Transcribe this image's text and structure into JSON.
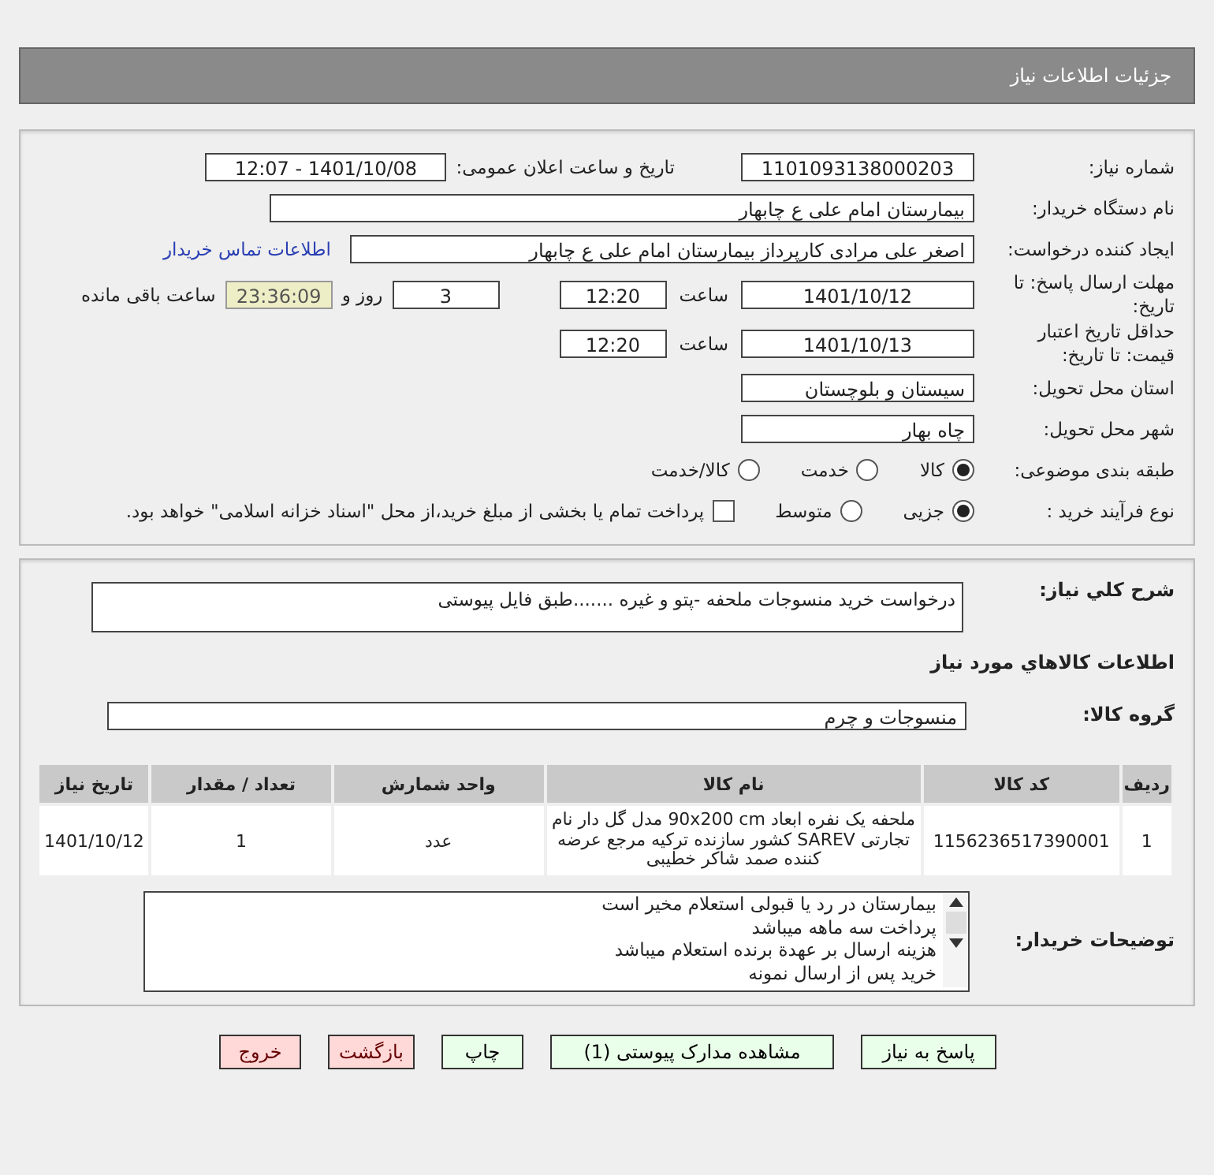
{
  "header": {
    "title": "جزئیات اطلاعات نیاز"
  },
  "need_number": {
    "label": "شماره نیاز:",
    "value": "1101093138000203"
  },
  "announce": {
    "label": "تاریخ و ساعت اعلان عمومی:",
    "value": "1401/10/08 - 12:07"
  },
  "buyer_org": {
    "label": "نام دستگاه خریدار:",
    "value": "بیمارستان امام علی  ع  چابهار"
  },
  "requester": {
    "label": "ایجاد کننده درخواست:",
    "value": "اصغر علی مرادی کارپرداز بیمارستان امام علی  ع  چابهار",
    "link": "اطلاعات تماس خریدار"
  },
  "deadline": {
    "label": "مهلت ارسال پاسخ: تا تاریخ:",
    "date": "1401/10/12",
    "time_label": "ساعت",
    "time": "12:20",
    "days": "3",
    "days_label": "روز و",
    "remaining": "23:36:09",
    "remaining_label": "ساعت باقی مانده"
  },
  "validity": {
    "label": "حداقل تاریخ اعتبار قیمت: تا تاریخ:",
    "date": "1401/10/13",
    "time_label": "ساعت",
    "time": "12:20"
  },
  "province": {
    "label": "استان محل تحویل:",
    "value": "سیستان و بلوچستان"
  },
  "city": {
    "label": "شهر محل تحویل:",
    "value": "چاه بهار"
  },
  "category": {
    "label": "طبقه بندی موضوعی:",
    "options": [
      {
        "kind": "radio",
        "label": "کالا",
        "selected": true
      },
      {
        "kind": "radio",
        "label": "خدمت",
        "selected": false
      },
      {
        "kind": "radio",
        "label": "کالا/خدمت",
        "selected": false
      }
    ]
  },
  "process": {
    "label": "نوع فرآیند خرید :",
    "options": [
      {
        "kind": "radio",
        "label": "جزیی",
        "selected": true
      },
      {
        "kind": "radio",
        "label": "متوسط",
        "selected": false
      },
      {
        "kind": "checkbox",
        "label": "پرداخت تمام یا بخشی از مبلغ خرید،از محل \"اسناد خزانه اسلامی\" خواهد بود.",
        "selected": false
      }
    ]
  },
  "summary": {
    "label": "شرح کلي نياز:",
    "value": "درخواست خرید منسوجات ملحفه -پتو و غیره .......طبق فایل پیوستی"
  },
  "goods_title": "اطلاعات کالاهاي مورد نياز",
  "goods_group": {
    "label": "گروه کالا:",
    "value": "منسوجات و چرم"
  },
  "table": {
    "columns": [
      "ردیف",
      "کد کالا",
      "نام کالا",
      "واحد شمارش",
      "تعداد / مقدار",
      "تاریخ نیاز"
    ],
    "rows": [
      [
        "1",
        "1156236517390001",
        "ملحفه یک نفره ابعاد 90x200 cm مدل گل دار نام تجارتی SAREV کشور سازنده ترکیه مرجع عرضه کننده صمد شاکر خطیبی",
        "عدد",
        "1",
        "1401/10/12"
      ]
    ]
  },
  "notes": {
    "label": "توضیحات خریدار:",
    "lines": [
      "بیمارستان در رد یا قبولی استعلام مخیر است",
      "پرداخت سه ماهه میباشد",
      "هزینه ارسال بر عهدة برنده استعلام میباشد",
      "خرید پس از ارسال نمونه"
    ]
  },
  "buttons": [
    {
      "label": "پاسخ به نیاز",
      "kind": "action"
    },
    {
      "label": "مشاهده مدارک پیوستی (1)",
      "kind": "action"
    },
    {
      "label": "چاپ",
      "kind": "action"
    },
    {
      "label": "بازگشت",
      "kind": "exit"
    },
    {
      "label": "خروج",
      "kind": "exit"
    }
  ]
}
